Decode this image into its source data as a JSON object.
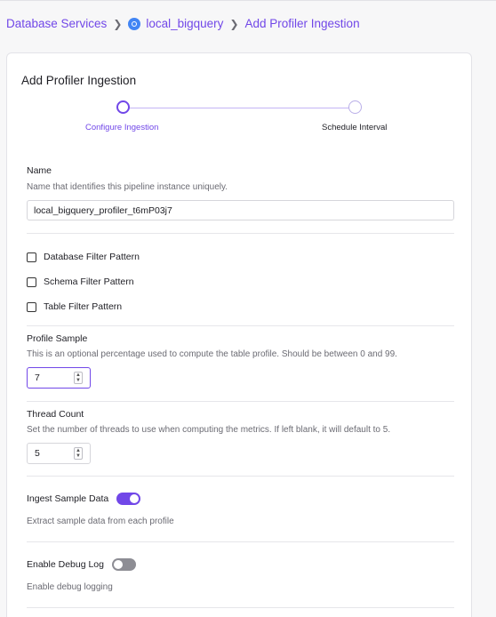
{
  "breadcrumb": {
    "item1": "Database Services",
    "item2": "local_bigquery",
    "item3": "Add Profiler Ingestion"
  },
  "card": {
    "title": "Add Profiler Ingestion"
  },
  "stepper": {
    "step1": "Configure Ingestion",
    "step2": "Schedule Interval"
  },
  "name_field": {
    "label": "Name",
    "description": "Name that identifies this pipeline instance uniquely.",
    "value": "local_bigquery_profiler_t6mP03j7"
  },
  "filters": {
    "database": "Database Filter Pattern",
    "schema": "Schema Filter Pattern",
    "table": "Table Filter Pattern"
  },
  "profile_sample": {
    "label": "Profile Sample",
    "description": "This is an optional percentage used to compute the table profile. Should be between 0 and 99.",
    "value": "7"
  },
  "thread_count": {
    "label": "Thread Count",
    "description": "Set the number of threads to use when computing the metrics. If left blank, it will default to 5.",
    "value": "5"
  },
  "ingest_sample": {
    "label": "Ingest Sample Data",
    "description": "Extract sample data from each profile",
    "enabled": true
  },
  "debug_log": {
    "label": "Enable Debug Log",
    "description": "Enable debug logging",
    "enabled": false
  },
  "colors": {
    "accent": "#7147e8",
    "bigquery": "#4285f4"
  }
}
